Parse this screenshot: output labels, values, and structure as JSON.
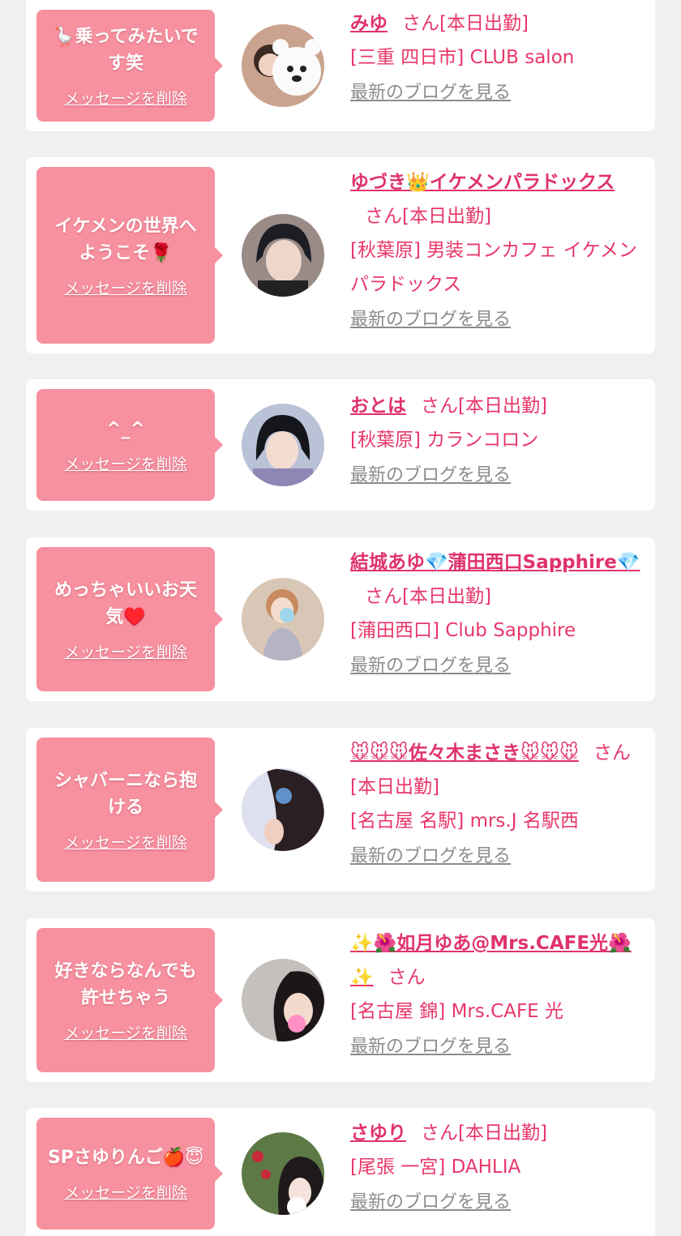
{
  "colors": {
    "background": "#f0f0f0",
    "card": "#ffffff",
    "bubble": "#f7909f",
    "accent": "#e0336a",
    "link_gray": "#8c8c8c"
  },
  "cards": [
    {
      "message": "🪿乗ってみたいです笑",
      "delete_label": "メッセージを削除",
      "name": "みゆ",
      "san_label": "さん[本日出勤]",
      "shop": "[三重 四日市] CLUB salon",
      "blog_label": "最新のブログを見る"
    },
    {
      "message": "イケメンの世界へようこそ🌹",
      "delete_label": "メッセージを削除",
      "name": "ゆづき👑イケメンパラドックス",
      "san_label": "さん[本日出勤]",
      "shop": "[秋葉原] 男装コンカフェ イケメンパラドックス",
      "blog_label": "最新のブログを見る"
    },
    {
      "message": "^_^",
      "delete_label": "メッセージを削除",
      "name": "おとは",
      "san_label": "さん[本日出勤]",
      "shop": "[秋葉原] カランコロン",
      "blog_label": "最新のブログを見る"
    },
    {
      "message": "めっちゃいいお天気♥️",
      "delete_label": "メッセージを削除",
      "name": "結城あゆ💎蒲田西口Sapphire💎",
      "san_label": "さん[本日出勤]",
      "shop": "[蒲田西口] Club Sapphire",
      "blog_label": "最新のブログを見る"
    },
    {
      "message": "シャバーニなら抱ける",
      "delete_label": "メッセージを削除",
      "name": "🐭🐭🐭佐々木まさき🐭🐭🐭",
      "san_label": "さん[本日出勤]",
      "shop": "[名古屋 名駅] mrs.J 名駅西",
      "blog_label": "最新のブログを見る"
    },
    {
      "message": "好きならなんでも許せちゃう",
      "delete_label": "メッセージを削除",
      "name": "✨🌺如月ゆあ@Mrs.CAFE光🌺✨",
      "san_label": "さん",
      "shop": "[名古屋 錦] Mrs.CAFE 光",
      "blog_label": "最新のブログを見る"
    },
    {
      "message": "SPさゆりんご🍎😇",
      "delete_label": "メッセージを削除",
      "name": "さゆり",
      "san_label": "さん[本日出勤]",
      "shop": "[尾張 一宮] DAHLIA",
      "blog_label": "最新のブログを見る"
    }
  ]
}
